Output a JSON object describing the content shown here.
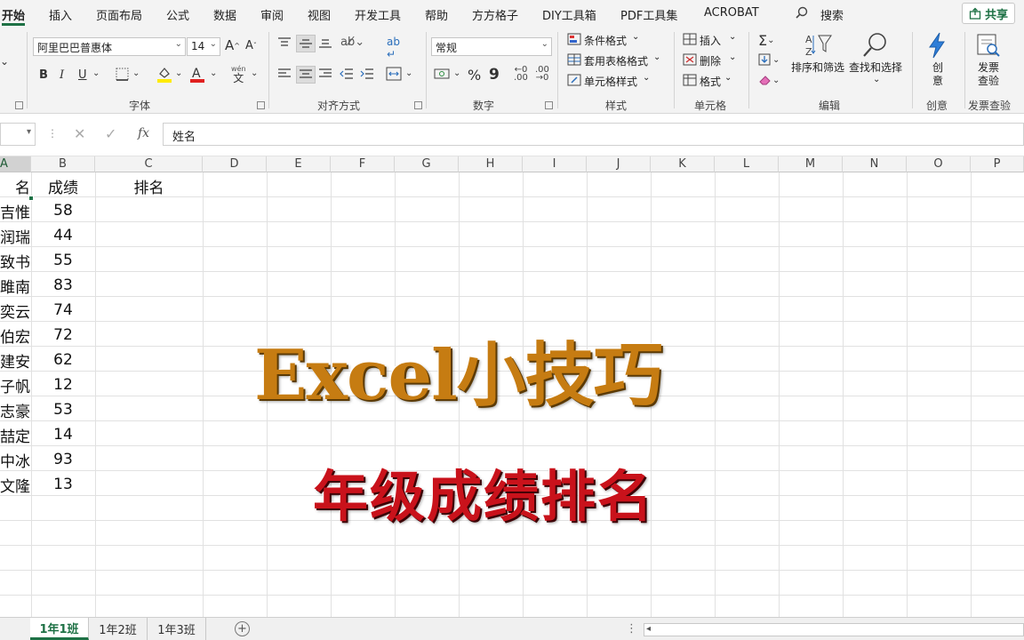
{
  "menu": {
    "tabs": [
      "开始",
      "插入",
      "页面布局",
      "公式",
      "数据",
      "审阅",
      "视图",
      "开发工具",
      "帮助",
      "方方格子",
      "DIY工具箱",
      "PDF工具集",
      "ACROBAT"
    ],
    "search_label": "搜索",
    "share_label": "共享"
  },
  "ribbon": {
    "font": {
      "group_label": "字体",
      "font_name": "阿里巴巴普惠体",
      "font_size": "14",
      "bold": "B",
      "italic": "I",
      "underline": "U",
      "grow": "A",
      "shrink": "A",
      "phonetic": "wén",
      "phonetic_char": "文"
    },
    "alignment": {
      "group_label": "对齐方式"
    },
    "number": {
      "group_label": "数字",
      "format": "常规",
      "percent": "%",
      "comma": "9"
    },
    "styles": {
      "group_label": "样式",
      "conditional": "条件格式",
      "table_format": "套用表格格式",
      "cell_styles": "单元格样式"
    },
    "cells": {
      "group_label": "单元格",
      "insert": "插入",
      "delete": "删除",
      "format": "格式"
    },
    "editing": {
      "group_label": "编辑",
      "sort_filter": "排序和筛选",
      "find_select": "查找和选择"
    },
    "create": {
      "group_label": "创意",
      "label_line1": "创",
      "label_line2": "意"
    },
    "invoice": {
      "group_label": "发票查验",
      "label_line1": "发票",
      "label_line2": "查验"
    }
  },
  "formula_bar": {
    "fx": "fx",
    "value": "姓名"
  },
  "columns": [
    "A",
    "B",
    "C",
    "D",
    "E",
    "F",
    "G",
    "H",
    "I",
    "J",
    "K",
    "L",
    "M",
    "N",
    "O",
    "P"
  ],
  "sheet": {
    "header": {
      "name": "名",
      "score": "成绩",
      "rank": "排名"
    },
    "rows": [
      {
        "name": "吉惟",
        "score": "58"
      },
      {
        "name": "润瑞",
        "score": "44"
      },
      {
        "name": "致书",
        "score": "55"
      },
      {
        "name": "雎南",
        "score": "83"
      },
      {
        "name": "奕云",
        "score": "74"
      },
      {
        "name": "伯宏",
        "score": "72"
      },
      {
        "name": "建安",
        "score": "62"
      },
      {
        "name": "子帆",
        "score": "12"
      },
      {
        "name": "志豪",
        "score": "53"
      },
      {
        "name": "喆定",
        "score": "14"
      },
      {
        "name": "中冰",
        "score": "93"
      },
      {
        "name": "文隆",
        "score": "13"
      }
    ]
  },
  "overlay": {
    "title": "Excel小技巧",
    "subtitle": "年级成绩排名",
    "title_color": "#c67c12",
    "subtitle_color": "#c9121b"
  },
  "sheet_tabs": [
    "1年1班",
    "1年2班",
    "1年3班"
  ],
  "accent_color": "#1e7145"
}
